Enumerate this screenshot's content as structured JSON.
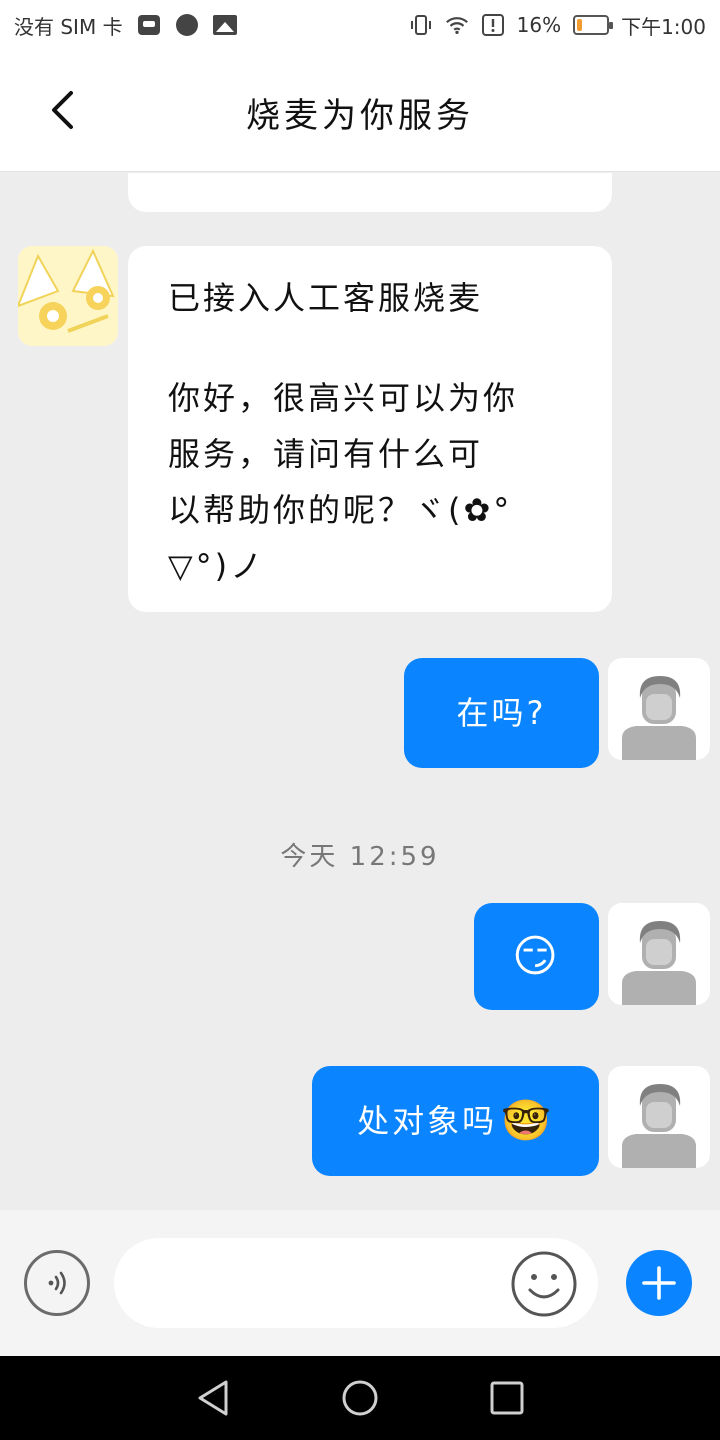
{
  "status_bar": {
    "carrier": "没有 SIM 卡",
    "battery_percent": "16%",
    "battery_level": 0.16,
    "time": "下午1:00",
    "icons": [
      "huawei-store-icon",
      "dot-icon",
      "image-icon",
      "vibrate-icon",
      "wifi-icon",
      "alert-icon",
      "battery-icon"
    ]
  },
  "header": {
    "title": "烧麦为你服务",
    "back_icon": "back-chevron-icon"
  },
  "messages": {
    "partial_top": "",
    "agent": {
      "line1": "已接入人工客服烧麦",
      "line2": "你好，很高兴可以为你",
      "line3": "服务，请问有什么可",
      "line4": "以帮助你的呢？ヾ(✿°",
      "line5": "▽°)ノ"
    },
    "user1": "在吗?",
    "timestamp": "今天  12:59",
    "user2_emoji": "😏",
    "user3_text": "处对象吗",
    "user3_emoji": "🤓"
  },
  "input": {
    "placeholder": "",
    "voice_icon": "voice-icon",
    "emoji_icon": "smiley-icon",
    "plus_icon": "plus-icon"
  },
  "nav": {
    "icons": [
      "back-triangle-icon",
      "home-circle-icon",
      "recents-square-icon"
    ]
  },
  "colors": {
    "accent": "#0a84ff",
    "chat_bg": "#ededed",
    "battery": "#f29b30"
  }
}
